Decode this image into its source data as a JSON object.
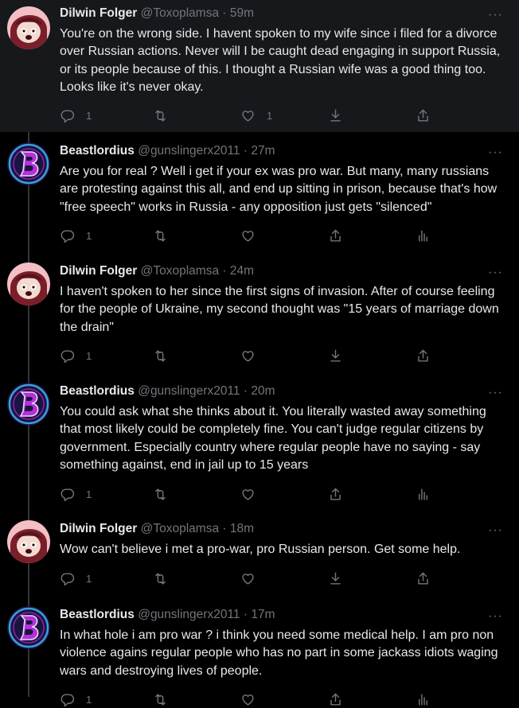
{
  "colors": {
    "background": "#000000",
    "highlight": "#16181c",
    "muted": "#71767b",
    "text": "#e7e9ea",
    "thread_line": "#333639"
  },
  "more_label": "···",
  "tweets": [
    {
      "name": "Dilwin Folger",
      "handle": "@Toxoplamsa",
      "time": "59m",
      "text": "You're on the wrong side. I havent spoken to my wife since i filed for a divorce over Russian actions. Never will I be caught dead engaging in support Russia, or its people because of this. I thought a Russian wife was a good thing too. Looks like it's never okay.",
      "avatar": "dilwin-avatar",
      "counts": {
        "replies": "1",
        "retweets": "",
        "likes": "1"
      },
      "analytics": false
    },
    {
      "name": "Beastlordius",
      "handle": "@gunslingerx2011",
      "time": "27m",
      "text": "Are you for real ? Well i get if your ex was pro war. But many, many russians are protesting against this all, and end up sitting in prison, because that's how \"free speech\" works in Russia - any opposition just gets \"silenced\"",
      "avatar": "beast-avatar",
      "counts": {
        "replies": "1",
        "retweets": "",
        "likes": ""
      },
      "analytics": true
    },
    {
      "name": "Dilwin Folger",
      "handle": "@Toxoplamsa",
      "time": "24m",
      "text": "I haven't spoken to her since the first signs of invasion. After of course feeling for the people of Ukraine, my second thought was \"15 years of marriage down the drain\"",
      "avatar": "dilwin-avatar",
      "counts": {
        "replies": "1",
        "retweets": "",
        "likes": ""
      },
      "analytics": false
    },
    {
      "name": "Beastlordius",
      "handle": "@gunslingerx2011",
      "time": "20m",
      "text": "You could ask what she thinks about it. You literally wasted away something that most likely could be completely fine. You can't judge regular citizens by government. Especially country where regular people have no saying - say something against, end in jail up to 15 years",
      "avatar": "beast-avatar",
      "counts": {
        "replies": "1",
        "retweets": "",
        "likes": ""
      },
      "analytics": true
    },
    {
      "name": "Dilwin Folger",
      "handle": "@Toxoplamsa",
      "time": "18m",
      "text": "Wow can't believe i met a pro-war, pro Russian person. Get some help.",
      "avatar": "dilwin-avatar",
      "counts": {
        "replies": "1",
        "retweets": "",
        "likes": ""
      },
      "analytics": false
    },
    {
      "name": "Beastlordius",
      "handle": "@gunslingerx2011",
      "time": "17m",
      "text": "In what hole i am pro war ? i think you need some medical help. I am pro non violence agains regular people who has no part in some jackass idiots waging wars and destroying lives of people.",
      "avatar": "beast-avatar",
      "counts": {
        "replies": "1",
        "retweets": "",
        "likes": ""
      },
      "analytics": true
    }
  ]
}
